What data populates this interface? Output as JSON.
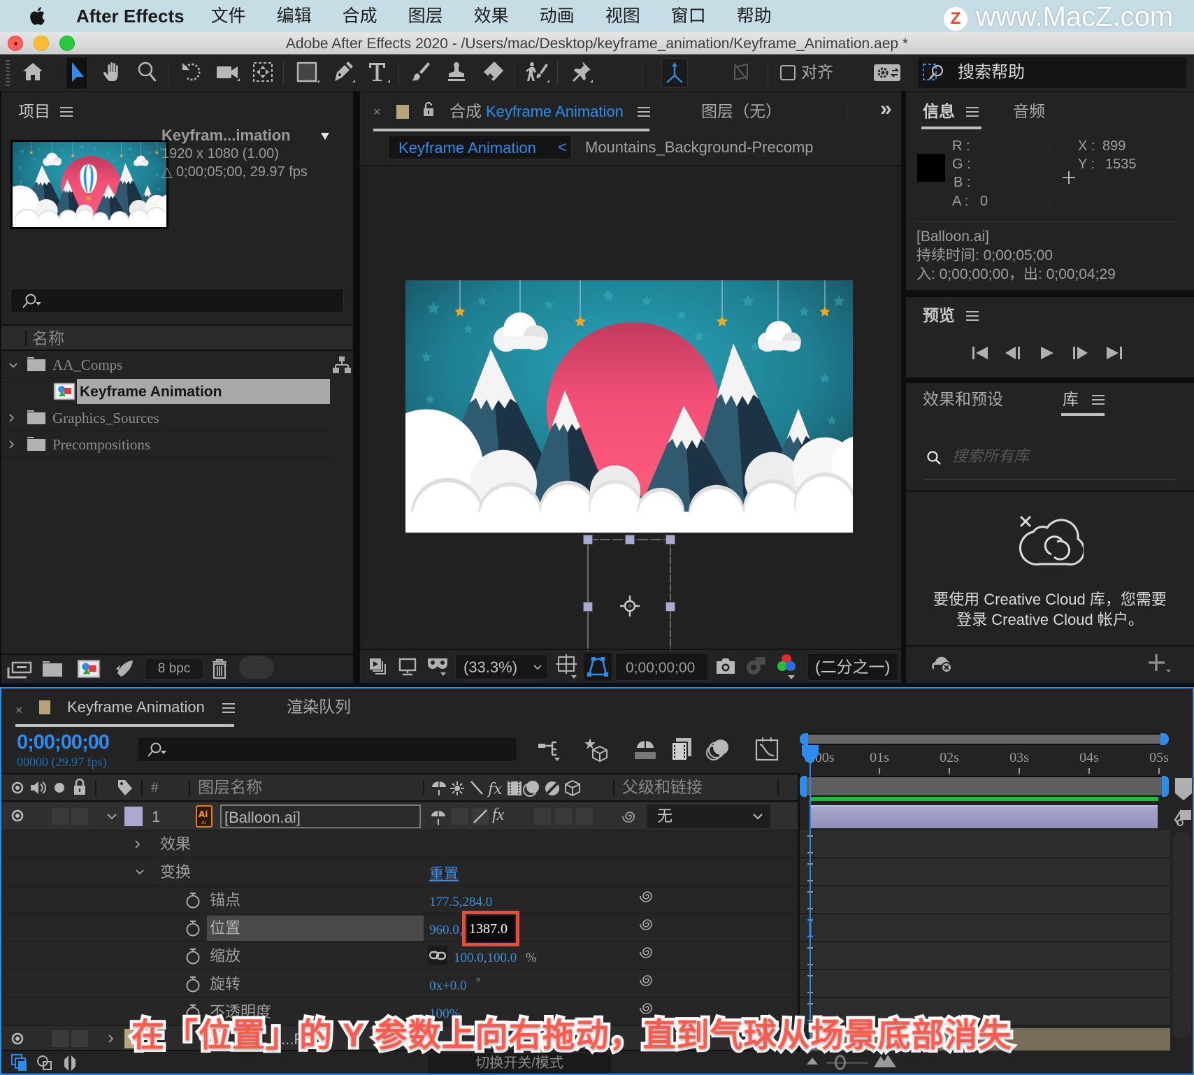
{
  "menubar": {
    "app_name": "After Effects",
    "items": [
      "文件",
      "编辑",
      "合成",
      "图层",
      "效果",
      "动画",
      "视图",
      "窗口",
      "帮助"
    ],
    "watermark_badge": "Z",
    "watermark_text": "www.MacZ.com"
  },
  "window": {
    "title": "Adobe After Effects 2020 - /Users/mac/Desktop/keyframe_animation/Keyframe_Animation.aep *"
  },
  "toolbar": {
    "tools": [
      "home",
      "selection",
      "hand",
      "zoom",
      "rotation",
      "camera",
      "pan-behind",
      "rectangle",
      "pen",
      "type",
      "brush",
      "clone-stamp",
      "eraser",
      "roto-brush",
      "puppet-pin"
    ],
    "active_tool": "selection",
    "axis_modes": [
      "local-axis",
      "world-axis",
      "view-axis"
    ],
    "align_label": "对齐",
    "align_checked": false,
    "search_help_label": "搜索帮助"
  },
  "project": {
    "title": "项目",
    "selected_item": {
      "name": "Keyfram...imation",
      "resolution": "1920 x 1080 (1.00)",
      "duration": "△ 0;00;05;00, 29.97 fps"
    },
    "search_value": "",
    "column_name": "名称",
    "tree": [
      {
        "name": "AA_Comps",
        "type": "folder",
        "expanded": true
      },
      {
        "name": "Keyframe Animation",
        "type": "composition",
        "selected": true
      },
      {
        "name": "Graphics_Sources",
        "type": "folder",
        "expanded": false
      },
      {
        "name": "Precompositions",
        "type": "folder",
        "expanded": false
      }
    ],
    "bit_depth": "8 bpc"
  },
  "composition": {
    "tab_prefix": "合成",
    "tab_name": "Keyframe Animation",
    "layer_tab": "图层（无）",
    "breadcrumb": [
      "Keyframe Animation",
      "Mountains_Background-Precomp"
    ],
    "breadcrumb_sep": "<",
    "zoom": "(33.3%)",
    "timecode": "0;00;00;00",
    "resolution": "(二分之一)",
    "label_color": "#b8a47c"
  },
  "info": {
    "tabs": [
      "信息",
      "音频"
    ],
    "r_label": "R :",
    "g_label": "G :",
    "b_label": "B :",
    "a_label": "A :",
    "a_value": "0",
    "x_label": "X :",
    "x_value": "899",
    "y_label": "Y :",
    "y_value": "1535",
    "swatch_color": "#000000",
    "layer_name": "[Balloon.ai]",
    "duration": "持续时间: 0;00;05;00",
    "in_out": "入: 0;00;00;00，出: 0;00;04;29"
  },
  "preview": {
    "title": "预览",
    "controls": [
      "first-frame",
      "previous-frame",
      "play",
      "next-frame",
      "last-frame"
    ]
  },
  "library": {
    "tabs": [
      "效果和预设",
      "库"
    ],
    "search_placeholder": "搜索所有库",
    "message": [
      "要使用 Creative Cloud 库，您需要",
      "登录 Creative Cloud 帐户。"
    ]
  },
  "timeline": {
    "tabs": [
      "Keyframe Animation",
      "渲染队列"
    ],
    "timecode": "0;00;00;00",
    "frame_info": "00000 (29.97 fps)",
    "search_value": "",
    "columns": {
      "number": "#",
      "layer_name": "图层名称",
      "parent": "父级和链接"
    },
    "ruler": [
      "0:00s",
      "01s",
      "02s",
      "03s",
      "04s",
      "05s"
    ],
    "playhead_time_s": 0,
    "duration_s": 5,
    "layers": [
      {
        "index": "1",
        "name": "[Balloon.ai]",
        "label_color": "#a9a9d1",
        "parent": "无",
        "bar_color": "#9b9bc4"
      },
      {
        "name": "...Prec",
        "label_color": "#b8a47c",
        "bar_color": "#786c5a"
      }
    ],
    "groups": {
      "effects": "效果",
      "transform": "变换",
      "reset": "重置"
    },
    "properties": [
      {
        "name": "锚点",
        "value": "177.5,284.0"
      },
      {
        "name": "位置",
        "x": "960.0",
        "sep": ",",
        "y": "1387.0",
        "editing": "y"
      },
      {
        "name": "缩放",
        "value": "100.0,100.0",
        "unit": "%"
      },
      {
        "name": "旋转",
        "value": "0x+0.0",
        "unit": "°"
      },
      {
        "name": "不透明度",
        "value": "100%"
      }
    ],
    "switch_mode": "切换开关/模式"
  },
  "subtitle": "在「位置」的 Y 参数上向右拖动，直到气球从场景底部消失",
  "colors": {
    "accent": "#2d8ceb",
    "subtitle": "#ff5a4e",
    "panel": "#232323",
    "highlight_box": "#f0493c"
  }
}
